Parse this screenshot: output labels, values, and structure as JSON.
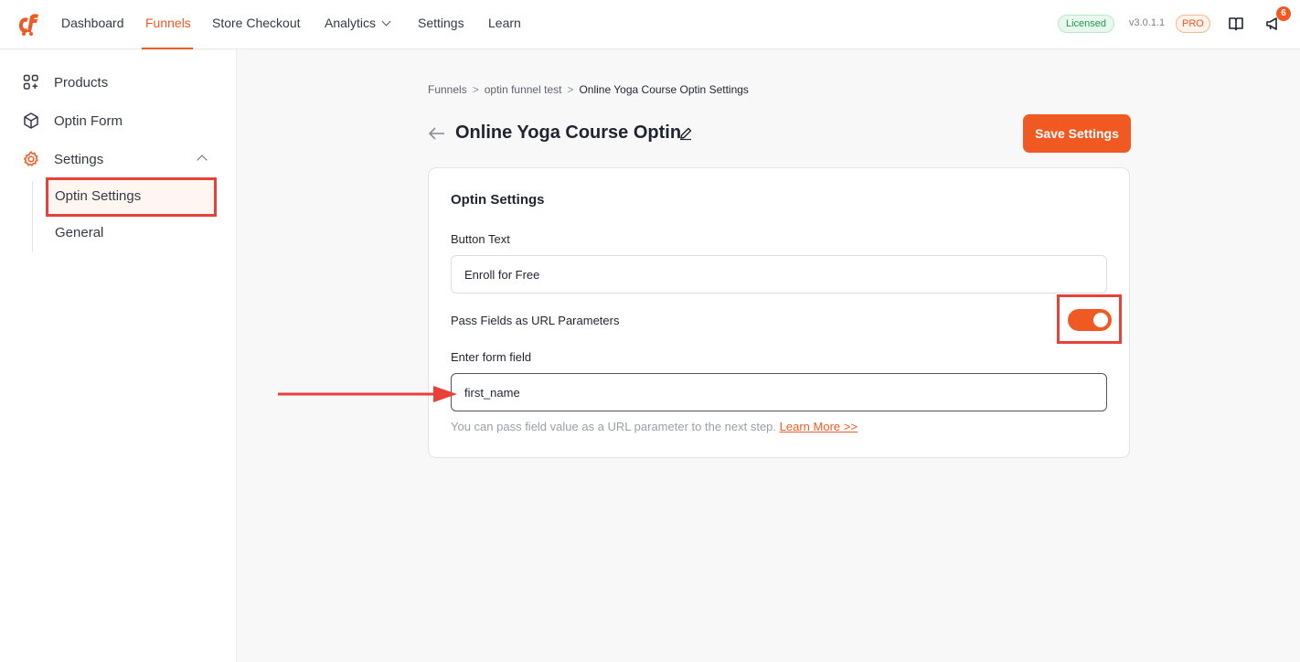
{
  "nav": {
    "items": [
      "Dashboard",
      "Funnels",
      "Store Checkout",
      "Analytics",
      "Settings",
      "Learn"
    ],
    "active": "Funnels",
    "licensed_badge": "Licensed",
    "version": "v3.0.1.1",
    "pro_badge": "PRO",
    "notification_count": "6",
    "accent_color": "#f05a22"
  },
  "sidebar": {
    "items": [
      "Products",
      "Optin Form",
      "Settings"
    ],
    "sub_items": [
      "Optin Settings",
      "General"
    ],
    "active_sub": "Optin Settings"
  },
  "breadcrumb": [
    "Funnels",
    "optin funnel test",
    "Online Yoga Course Optin Settings"
  ],
  "page": {
    "title": "Online Yoga Course Optin",
    "save_label": "Save Settings"
  },
  "card": {
    "title": "Optin Settings",
    "button_text_label": "Button Text",
    "button_text_value": "Enroll for Free",
    "pass_fields_label": "Pass Fields as URL Parameters",
    "pass_fields_enabled": true,
    "form_field_label": "Enter form field",
    "form_field_value": "first_name",
    "help_text": "You can pass field value as a URL parameter to the next step.",
    "learn_more": "Learn More >>"
  }
}
